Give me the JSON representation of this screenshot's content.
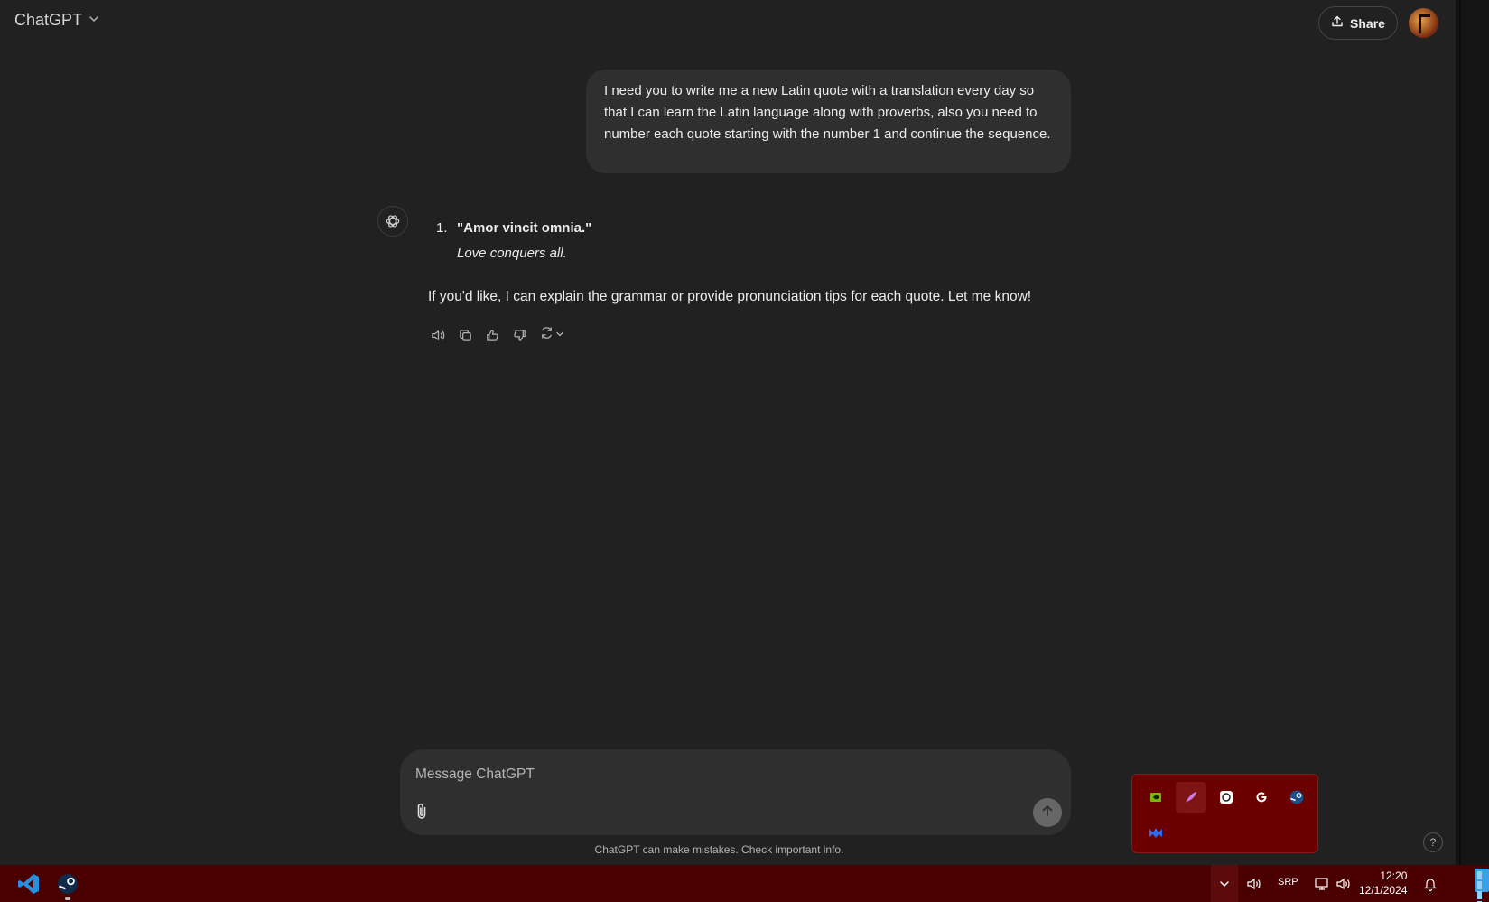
{
  "header": {
    "model_label": "ChatGPT",
    "share_label": "Share"
  },
  "conversation": {
    "user_message": "I need you to write me a new Latin quote with a translation every day so that I can learn the Latin language along with proverbs, also you need to number each quote starting with the number 1 and continue the sequence.",
    "assistant": {
      "quote_number": "1.",
      "quote_latin": "\"Amor vincit omnia.\"",
      "quote_translation": "Love conquers all.",
      "followup": "If you'd like, I can explain the grammar or provide pronunciation tips for each quote. Let me know!"
    }
  },
  "composer": {
    "placeholder": "Message ChatGPT",
    "value": ""
  },
  "disclaimer": "ChatGPT can make mistakes. Check important info.",
  "help_label": "?",
  "taskbar": {
    "language": "SRP",
    "time": "12:20",
    "date": "12/1/2024"
  },
  "colors": {
    "background": "#212121",
    "bubble": "#2f2f2f",
    "taskbar": "#4a0000",
    "tray_popup": "#6b0000"
  },
  "icons": {
    "tray": [
      "nvidia-icon",
      "feather-icon",
      "chatgpt-icon",
      "logitech-icon",
      "steam-icon",
      "malwarebytes-icon"
    ],
    "taskbar_apps": [
      "vscode-icon",
      "steam-icon"
    ]
  }
}
